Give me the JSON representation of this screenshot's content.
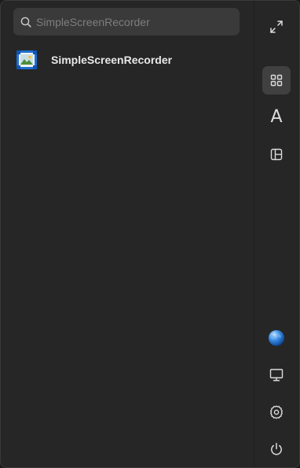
{
  "search": {
    "placeholder": "SimpleScreenRecorder",
    "value": ""
  },
  "results": [
    {
      "label": "SimpleScreenRecorder",
      "icon": "simplescreenrecorder-app-icon"
    }
  ],
  "sidebar": {
    "top": [
      {
        "name": "fullscreen-toggle",
        "icon": "expand-icon"
      }
    ],
    "modes": [
      {
        "name": "all-apps-grid",
        "icon": "grid-icon",
        "active": true
      },
      {
        "name": "alphabetical-sort",
        "icon": "letter-a-icon",
        "glyph": "A",
        "active": false
      },
      {
        "name": "category-view",
        "icon": "category-layout-icon",
        "active": false
      }
    ],
    "bottom": [
      {
        "name": "network-globe",
        "icon": "globe-icon"
      },
      {
        "name": "display-monitor",
        "icon": "monitor-icon"
      },
      {
        "name": "settings",
        "icon": "gear-icon"
      },
      {
        "name": "power",
        "icon": "power-icon"
      }
    ]
  },
  "colors": {
    "panel": "#262626",
    "search_bg": "#3a3a3a",
    "active_bg": "#404040",
    "text": "#e8e8e8",
    "placeholder": "#7e7e7e",
    "accent_blue": "#2a7de1"
  }
}
